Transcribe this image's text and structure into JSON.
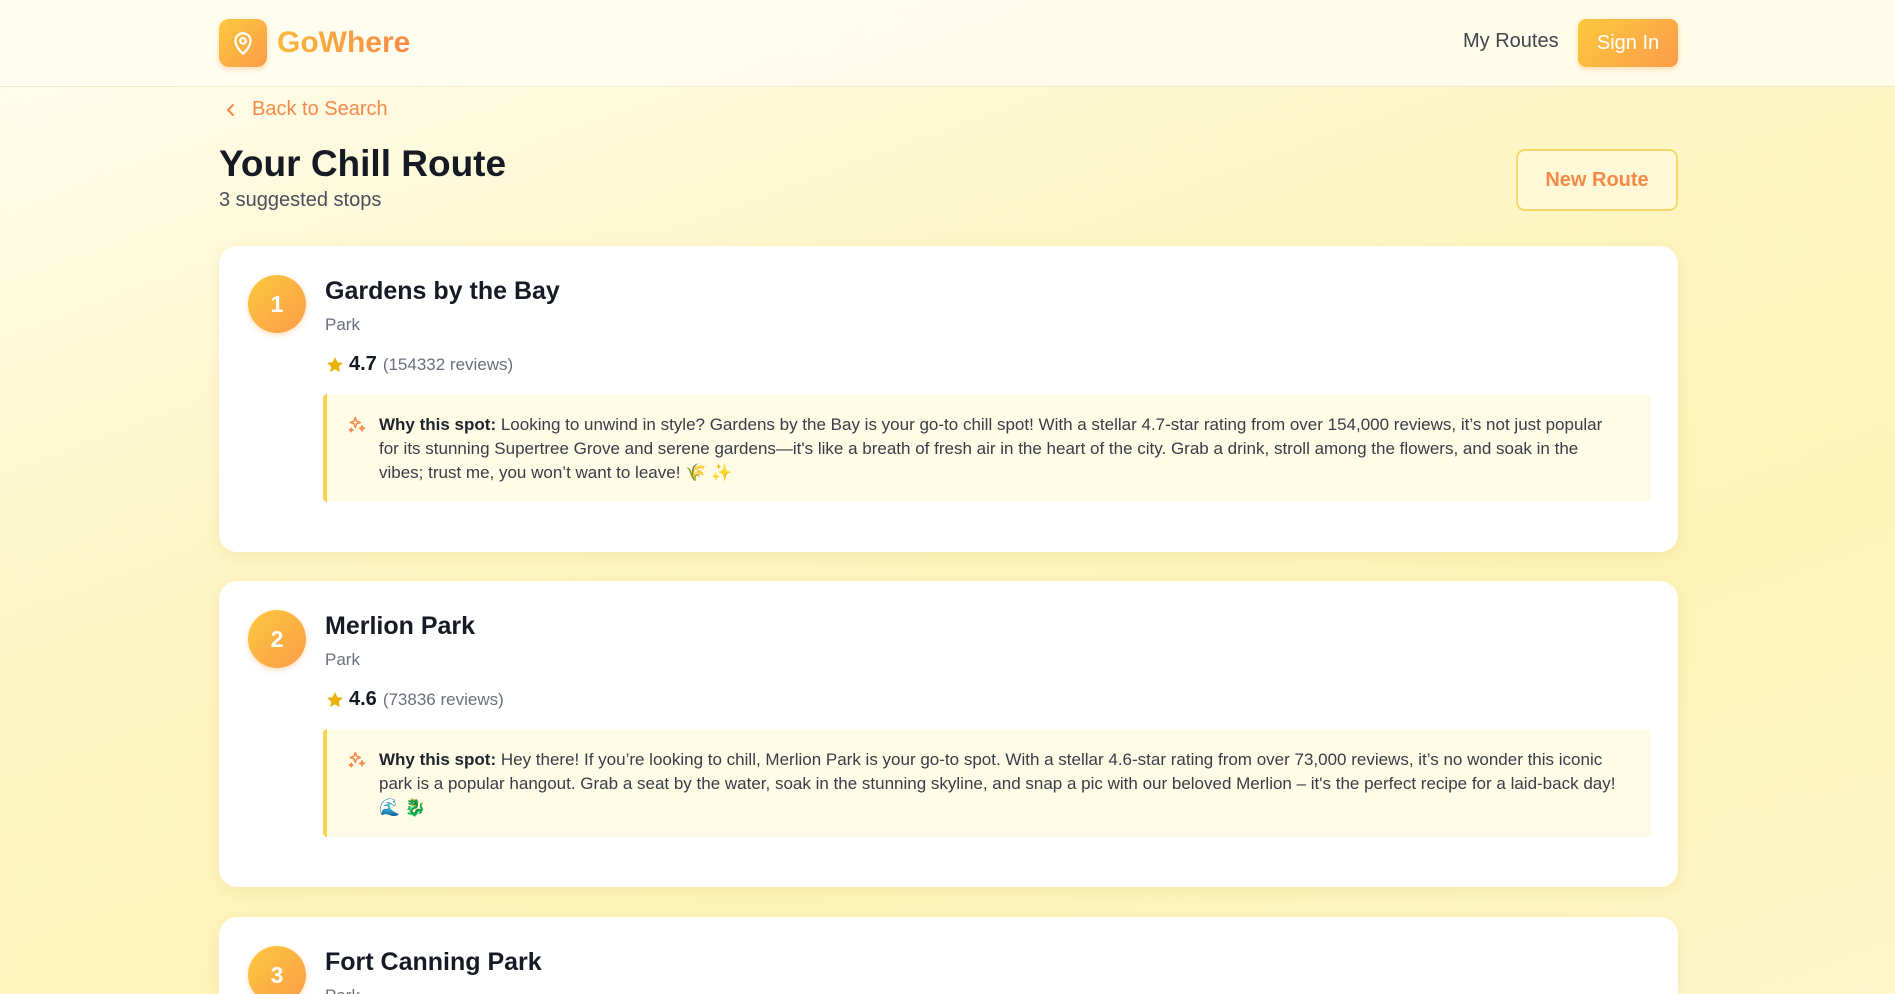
{
  "brand": {
    "name": "GoWhere"
  },
  "nav": {
    "my_routes": "My Routes",
    "sign_in": "Sign In"
  },
  "back_link": "Back to Search",
  "page": {
    "title": "Your Chill Route",
    "subtitle": "3 suggested stops",
    "new_route": "New Route"
  },
  "why_label": "Why this spot:",
  "colors": {
    "accent_start": "#fdc93d",
    "accent_end": "#fb9c4a",
    "link": "#f5894a",
    "star": "#eab308"
  },
  "stops": [
    {
      "number": "1",
      "name": "Gardens by the Bay",
      "category": "Park",
      "rating": "4.7",
      "reviews": "(154332 reviews)",
      "why": "Looking to unwind in style? Gardens by the Bay is your go-to chill spot! With a stellar 4.7-star rating from over 154,000 reviews, it’s not just popular for its stunning Supertree Grove and serene gardens—it's like a breath of fresh air in the heart of the city. Grab a drink, stroll among the flowers, and soak in the vibes; trust me, you won’t want to leave! 🌾 ✨"
    },
    {
      "number": "2",
      "name": "Merlion Park",
      "category": "Park",
      "rating": "4.6",
      "reviews": "(73836 reviews)",
      "why": "Hey there! If you’re looking to chill, Merlion Park is your go-to spot. With a stellar 4.6-star rating from over 73,000 reviews, it’s no wonder this iconic park is a popular hangout. Grab a seat by the water, soak in the stunning skyline, and snap a pic with our beloved Merlion – it's the perfect recipe for a laid-back day! 🌊 🐉"
    },
    {
      "number": "3",
      "name": "Fort Canning Park",
      "category": "Park"
    }
  ]
}
